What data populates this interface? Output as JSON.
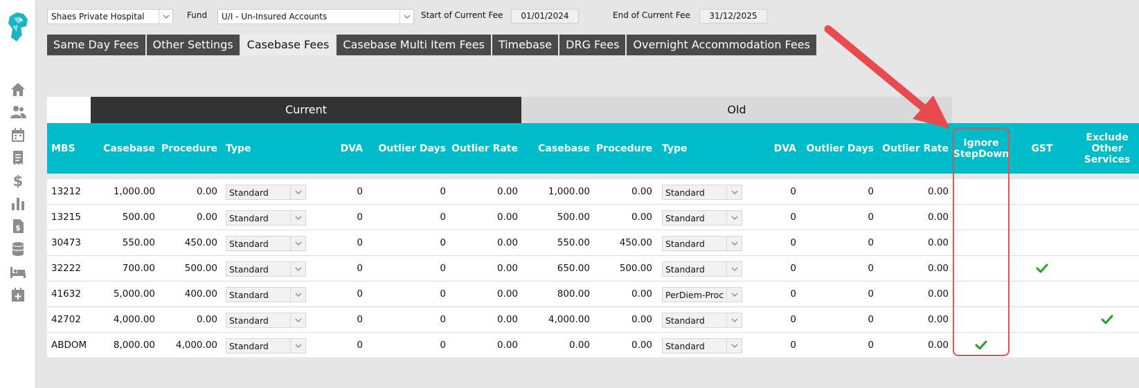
{
  "top_bar": {
    "hospital_select": "Shaes Private Hospital",
    "fund_label": "Fund",
    "fund_select": "U/I - Un-Insured Accounts",
    "start_label": "Start of Current Fee",
    "start_date": "01/01/2024",
    "end_label": "End of Current Fee",
    "end_date": "31/12/2025"
  },
  "tabs": [
    {
      "label": "Same Day Fees"
    },
    {
      "label": "Other Settings"
    },
    {
      "label": "Casebase Fees"
    },
    {
      "label": "Casebase Multi Item Fees"
    },
    {
      "label": "Timebase"
    },
    {
      "label": "DRG Fees"
    },
    {
      "label": "Overnight Accommodation Fees"
    }
  ],
  "active_tab": "Casebase Fees",
  "table": {
    "group_current": "Current",
    "group_old": "Old",
    "headers": {
      "mbs": "MBS",
      "casebase": "Casebase",
      "procedure": "Procedure",
      "type": "Type",
      "dva": "DVA",
      "outlier_days": "Outlier Days",
      "outlier_rate": "Outlier Rate",
      "old_casebase": "Casebase",
      "old_procedure": "Procedure",
      "old_type": "Type",
      "old_dva": "DVA",
      "old_outlier_days": "Outlier Days",
      "old_outlier_rate": "Outlier Rate",
      "ignore_stepdown_1": "Ignore",
      "ignore_stepdown_2": "StepDown",
      "gst": "GST",
      "exclude_1": "Exclude",
      "exclude_2": "Other",
      "exclude_3": "Services"
    },
    "rows": [
      {
        "mbs": "13212",
        "casebase": "1,000.00",
        "procedure": "0.00",
        "type": "Standard",
        "dva": "0",
        "outlier_days": "0",
        "outlier_rate": "0.00",
        "old_casebase": "1,000.00",
        "old_procedure": "0.00",
        "old_type": "Standard",
        "old_dva": "0",
        "old_outlier_days": "0",
        "old_outlier_rate": "0.00",
        "ignore_stepdown": false,
        "gst": false,
        "exclude": false
      },
      {
        "mbs": "13215",
        "casebase": "500.00",
        "procedure": "0.00",
        "type": "Standard",
        "dva": "0",
        "outlier_days": "0",
        "outlier_rate": "0.00",
        "old_casebase": "500.00",
        "old_procedure": "0.00",
        "old_type": "Standard",
        "old_dva": "0",
        "old_outlier_days": "0",
        "old_outlier_rate": "0.00",
        "ignore_stepdown": false,
        "gst": false,
        "exclude": false
      },
      {
        "mbs": "30473",
        "casebase": "550.00",
        "procedure": "450.00",
        "type": "Standard",
        "dva": "0",
        "outlier_days": "0",
        "outlier_rate": "0.00",
        "old_casebase": "550.00",
        "old_procedure": "450.00",
        "old_type": "Standard",
        "old_dva": "0",
        "old_outlier_days": "0",
        "old_outlier_rate": "0.00",
        "ignore_stepdown": false,
        "gst": false,
        "exclude": false
      },
      {
        "mbs": "32222",
        "casebase": "700.00",
        "procedure": "500.00",
        "type": "Standard",
        "dva": "0",
        "outlier_days": "0",
        "outlier_rate": "0.00",
        "old_casebase": "650.00",
        "old_procedure": "500.00",
        "old_type": "Standard",
        "old_dva": "0",
        "old_outlier_days": "0",
        "old_outlier_rate": "0.00",
        "ignore_stepdown": false,
        "gst": true,
        "exclude": false
      },
      {
        "mbs": "41632",
        "casebase": "5,000.00",
        "procedure": "400.00",
        "type": "Standard",
        "dva": "0",
        "outlier_days": "0",
        "outlier_rate": "0.00",
        "old_casebase": "800.00",
        "old_procedure": "0.00",
        "old_type": "PerDiem-Proc",
        "old_dva": "0",
        "old_outlier_days": "0",
        "old_outlier_rate": "0.00",
        "ignore_stepdown": false,
        "gst": false,
        "exclude": false
      },
      {
        "mbs": "42702",
        "casebase": "4,000.00",
        "procedure": "0.00",
        "type": "Standard",
        "dva": "0",
        "outlier_days": "0",
        "outlier_rate": "0.00",
        "old_casebase": "4,000.00",
        "old_procedure": "0.00",
        "old_type": "Standard",
        "old_dva": "0",
        "old_outlier_days": "0",
        "old_outlier_rate": "0.00",
        "ignore_stepdown": false,
        "gst": false,
        "exclude": true
      },
      {
        "mbs": "ABDOM",
        "casebase": "8,000.00",
        "procedure": "4,000.00",
        "type": "Standard",
        "dva": "0",
        "outlier_days": "0",
        "outlier_rate": "0.00",
        "old_casebase": "0.00",
        "old_procedure": "0.00",
        "old_type": "Standard",
        "old_dva": "0",
        "old_outlier_days": "0",
        "old_outlier_rate": "0.00",
        "ignore_stepdown": true,
        "gst": false,
        "exclude": false
      }
    ]
  },
  "icons": {
    "logo": "dog-head-logo-icon",
    "nav": [
      "home-icon",
      "users-icon",
      "calendar-icon",
      "receipt-icon",
      "dollar-icon",
      "bar-chart-icon",
      "invoice-icon",
      "database-icon",
      "bed-icon",
      "calendar-plus-icon"
    ],
    "check": "check-icon"
  },
  "colors": {
    "header_teal": "#00bccb",
    "tab_dark": "#4a4a4a",
    "current_group": "#333333",
    "old_group": "#d9d9d9",
    "check_green": "#1aa31a",
    "annotation_red": "#e0505a"
  }
}
